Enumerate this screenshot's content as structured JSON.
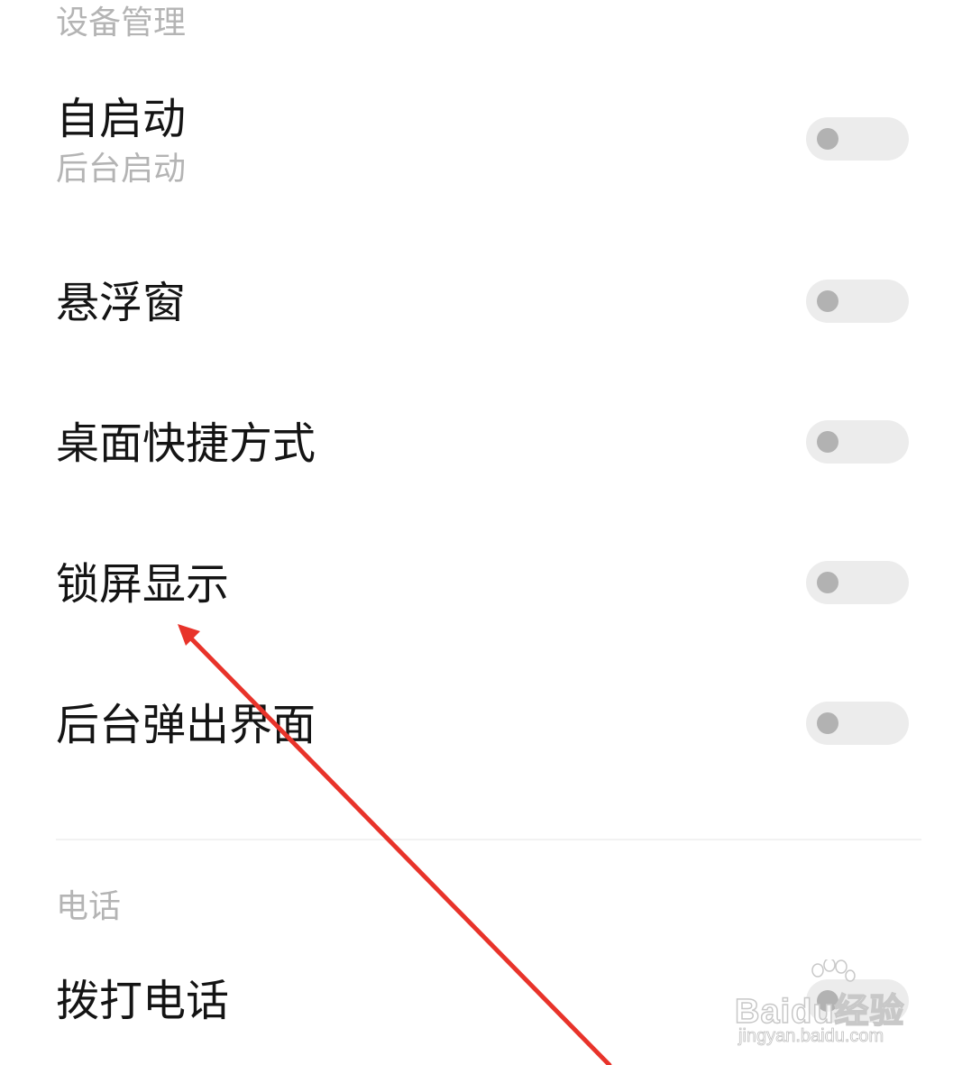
{
  "sections": {
    "device_management": {
      "header": "设备管理"
    },
    "phone": {
      "header": "电话"
    }
  },
  "rows": {
    "autostart": {
      "title": "自启动",
      "subtitle": "后台启动",
      "enabled": false
    },
    "floating_window": {
      "title": "悬浮窗",
      "enabled": false
    },
    "desktop_shortcut": {
      "title": "桌面快捷方式",
      "enabled": false
    },
    "lock_screen_display": {
      "title": "锁屏显示",
      "enabled": false
    },
    "background_popup": {
      "title": "后台弹出界面",
      "enabled": false
    },
    "make_calls": {
      "title": "拨打电话",
      "enabled": false
    }
  },
  "watermark": {
    "brand": "Baidu经验",
    "url": "jingyan.baidu.com"
  },
  "colors": {
    "annotation_arrow": "#e8332a",
    "toggle_track_off": "#ececec",
    "toggle_knob_off": "#b2b2b2",
    "section_header": "#b4b4b4",
    "row_title": "#141414"
  }
}
